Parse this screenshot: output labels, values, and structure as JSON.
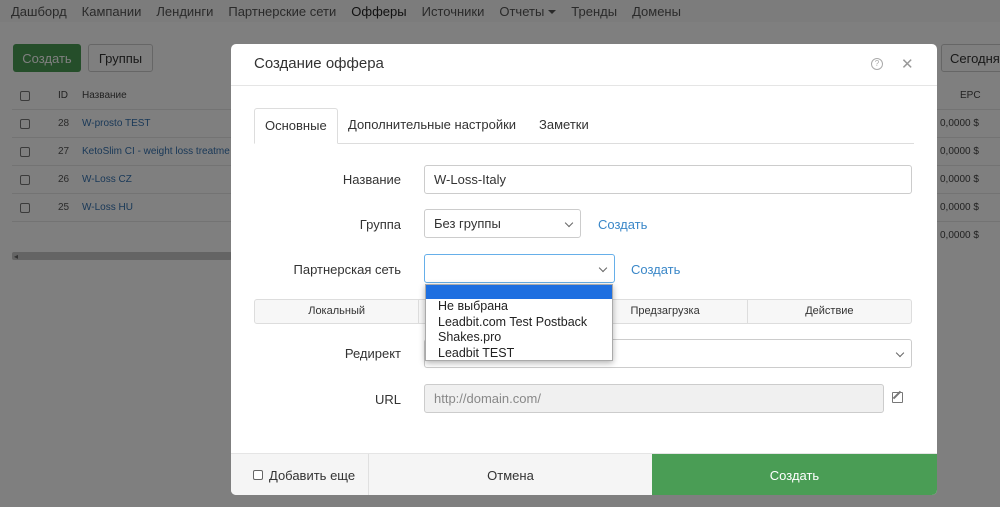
{
  "topnav": {
    "items": [
      "Дашборд",
      "Кампании",
      "Лендинги",
      "Партнерские сети",
      "Офферы",
      "Источники",
      "Отчеты",
      "Тренды",
      "Домены"
    ]
  },
  "background": {
    "create_label": "Создать",
    "groups_label": "Группы",
    "today_label": "Сегодня",
    "table": {
      "headers": {
        "id": "ID",
        "name": "Название",
        "epc": "EPC"
      },
      "rows": [
        {
          "id": "28",
          "name": "W-prosto TEST",
          "epc": "0,0000 $"
        },
        {
          "id": "27",
          "name": "KetoSlim CI - weight loss treatme",
          "epc": "0,0000 $"
        },
        {
          "id": "26",
          "name": "W-Loss CZ",
          "epc": "0,0000 $"
        },
        {
          "id": "25",
          "name": "W-Loss HU",
          "epc": "0,0000 $"
        }
      ],
      "total_epc": "0,0000 $"
    }
  },
  "modal": {
    "title": "Создание оффера",
    "tabs": [
      "Основные",
      "Дополнительные настройки",
      "Заметки"
    ],
    "fields": {
      "name": {
        "label": "Название",
        "value": "W-Loss-Italy"
      },
      "group": {
        "label": "Группа",
        "value": "Без группы",
        "create_link": "Создать"
      },
      "network": {
        "label": "Партнерская сеть",
        "value": "",
        "create_link": "Создать"
      },
      "redirect": {
        "label": "Редирект"
      },
      "url": {
        "label": "URL",
        "placeholder": "http://domain.com/"
      }
    },
    "segments": [
      "Локальный",
      "",
      "Предзагрузка",
      "Действие"
    ],
    "dropdown_options": [
      "Не выбрана",
      "Leadbit.com Test Postback",
      "Shakes.pro",
      "Leadbit TEST"
    ],
    "footer": {
      "add_more": "Добавить еще",
      "cancel": "Отмена",
      "create": "Создать"
    }
  }
}
